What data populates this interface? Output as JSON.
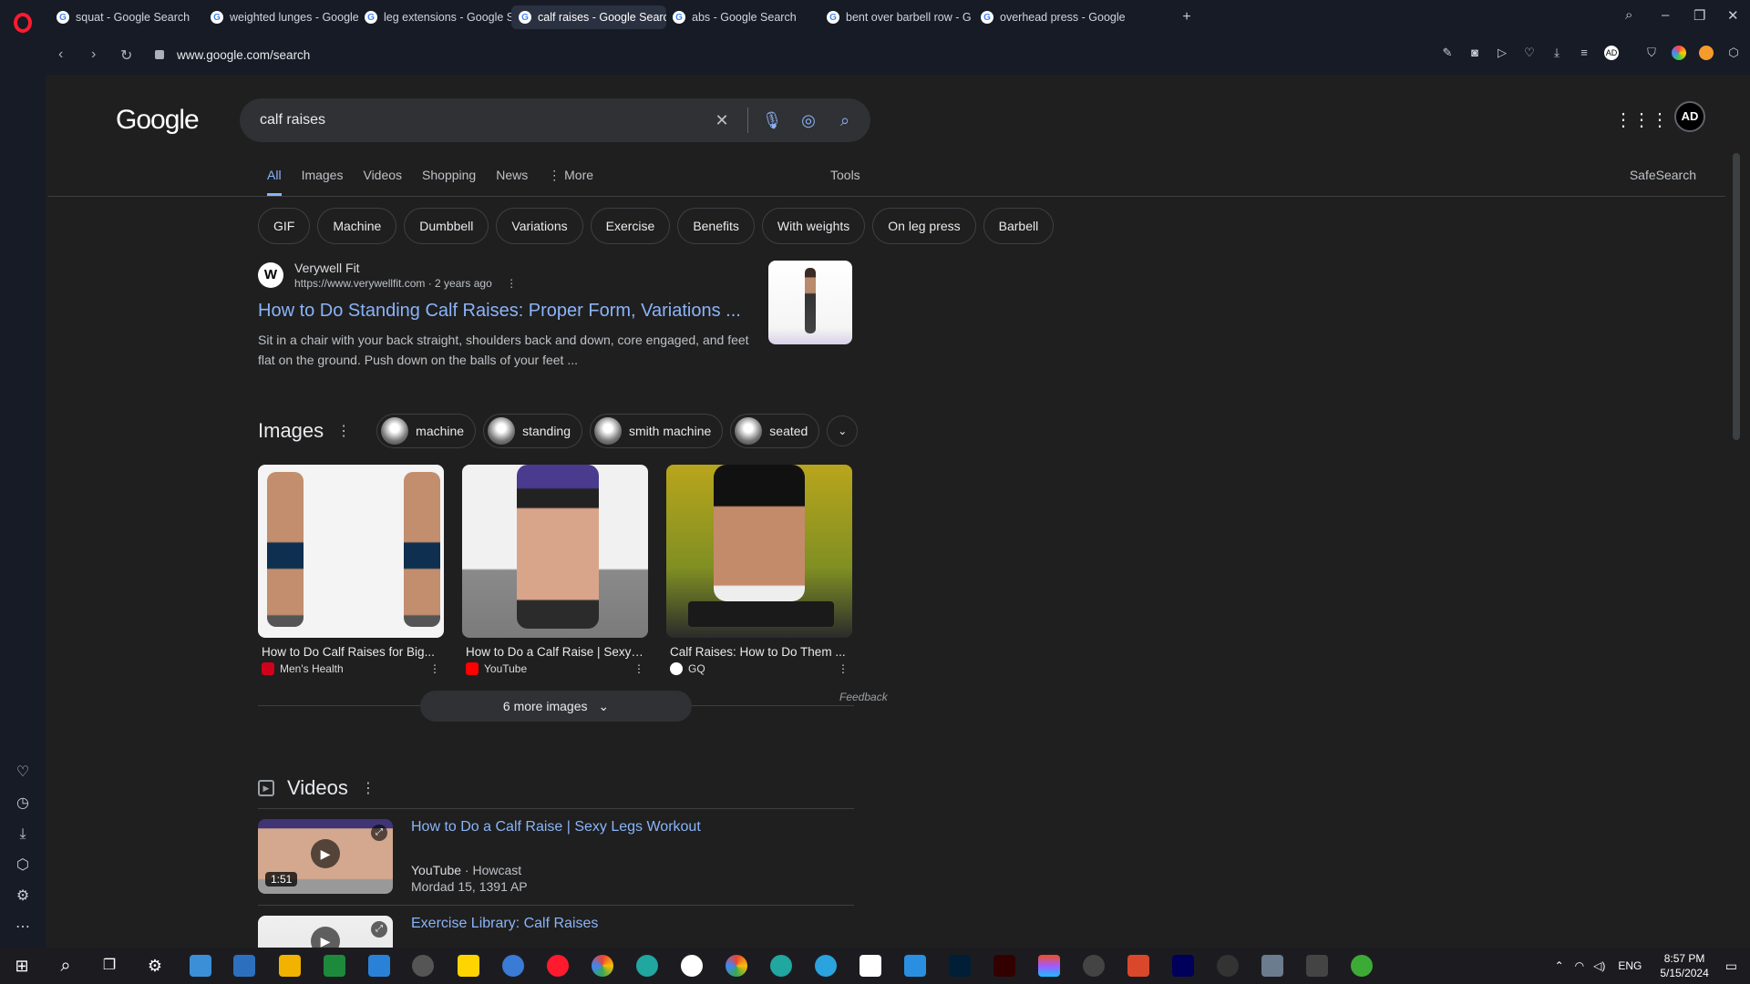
{
  "browser": {
    "tabs": [
      {
        "label": "squat - Google Search",
        "active": false
      },
      {
        "label": "weighted lunges - Google",
        "active": false
      },
      {
        "label": "leg extensions - Google S",
        "active": false
      },
      {
        "label": "calf raises - Google Search",
        "active": true
      },
      {
        "label": "abs - Google Search",
        "active": false
      },
      {
        "label": "bent over barbell row - G",
        "active": false
      },
      {
        "label": "overhead press - Google S",
        "active": false
      }
    ],
    "new_tab": "+",
    "url": "www.google.com/search"
  },
  "google": {
    "logo": "Google",
    "query": "calf raises",
    "tabs": [
      "All",
      "Images",
      "Videos",
      "Shopping",
      "News",
      "⋮ More"
    ],
    "tools": "Tools",
    "safesearch": "SafeSearch",
    "chips": [
      "GIF",
      "Machine",
      "Dumbbell",
      "Variations",
      "Exercise",
      "Benefits",
      "With weights",
      "On leg press",
      "Barbell"
    ]
  },
  "result": {
    "favicon": "W",
    "site": "Verywell Fit",
    "url": "https://www.verywellfit.com",
    "age": "2 years ago",
    "title": "How to Do Standing Calf Raises: Proper Form, Variations ...",
    "snippet": "Sit in a chair with your back straight, shoulders back and down, core engaged, and feet flat on the ground. Push down on the balls of your feet ..."
  },
  "images": {
    "heading": "Images",
    "chips": [
      "machine",
      "standing",
      "smith machine",
      "seated"
    ],
    "cards": [
      {
        "caption": "How to Do Calf Raises for Big...",
        "source": "Men's Health",
        "source_color": "#d0021b"
      },
      {
        "caption": "How to Do a Calf Raise | Sexy ...",
        "source": "YouTube",
        "source_color": "#ff0000"
      },
      {
        "caption": "Calf Raises: How to Do Them ...",
        "source": "GQ",
        "source_color": "#ffffff"
      }
    ],
    "feedback": "Feedback",
    "more": "6 more images"
  },
  "videos": {
    "heading": "Videos",
    "items": [
      {
        "title": "How to Do a Calf Raise | Sexy Legs Workout",
        "duration": "1:51",
        "platform": "YouTube",
        "channel": "Howcast",
        "date": "Mordad 15, 1391 AP"
      },
      {
        "title": "Exercise Library: Calf Raises"
      }
    ]
  },
  "taskbar": {
    "lang": "ENG",
    "time": "8:57 PM",
    "date": "5/15/2024"
  }
}
